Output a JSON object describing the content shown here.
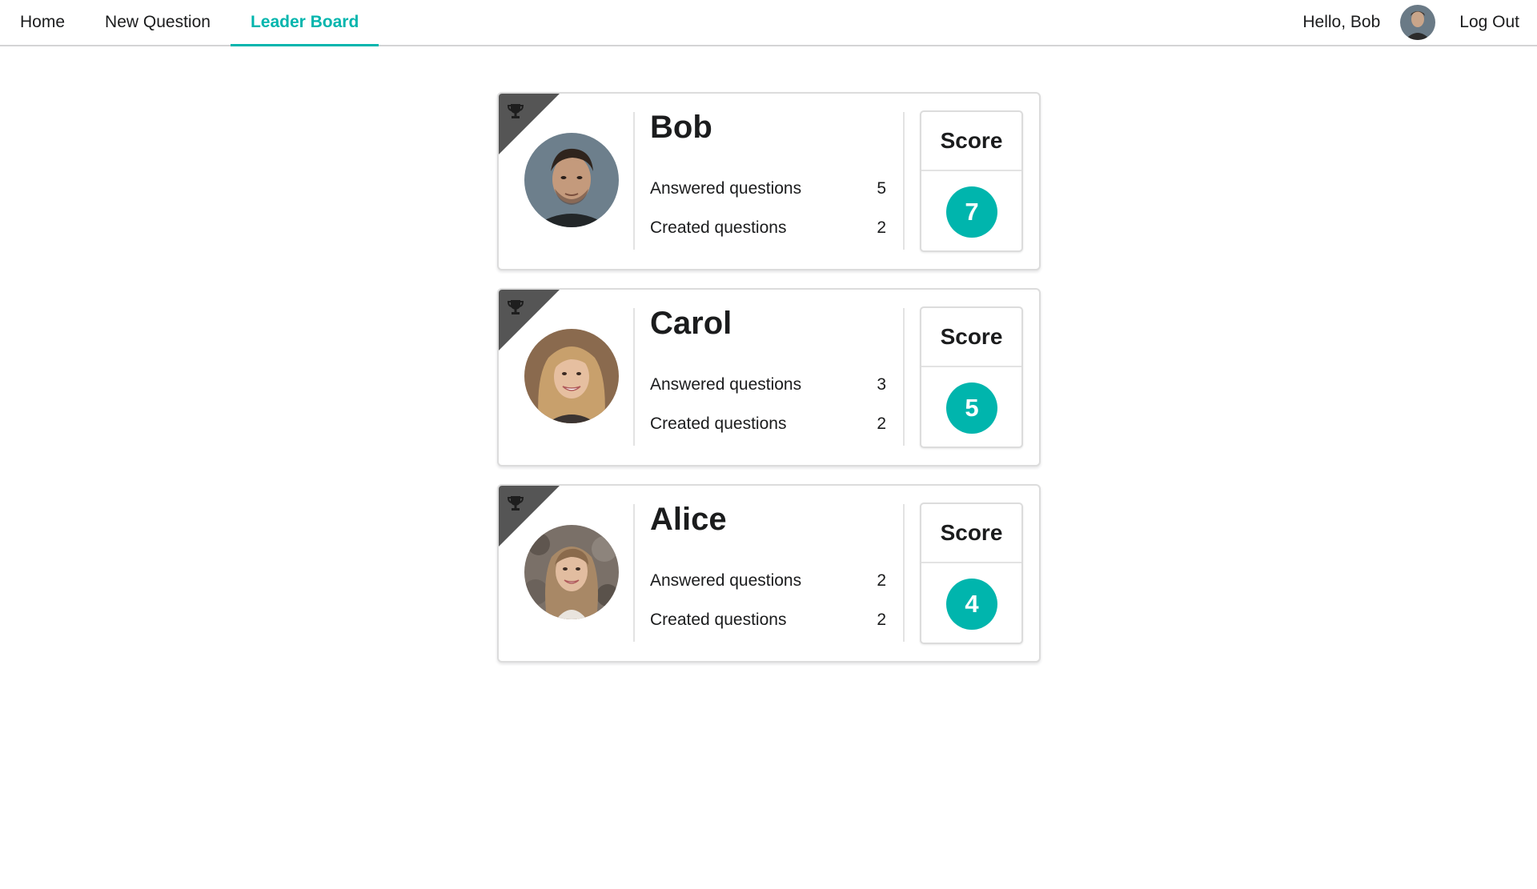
{
  "nav": {
    "items": [
      {
        "label": "Home",
        "active": false
      },
      {
        "label": "New Question",
        "active": false
      },
      {
        "label": "Leader Board",
        "active": true
      }
    ],
    "greeting": "Hello, Bob",
    "logout_label": "Log Out",
    "avatar_icon": "user-avatar-icon"
  },
  "colors": {
    "accent": "#00b5ad",
    "corner_ribbon": "#555555",
    "border": "#dcdcdc"
  },
  "leaderboard": {
    "score_label": "Score",
    "answered_label": "Answered questions",
    "created_label": "Created questions",
    "corner_icon": "trophy-icon",
    "users": [
      {
        "name": "Bob",
        "answered": "5",
        "created": "2",
        "score": "7"
      },
      {
        "name": "Carol",
        "answered": "3",
        "created": "2",
        "score": "5"
      },
      {
        "name": "Alice",
        "answered": "2",
        "created": "2",
        "score": "4"
      }
    ]
  }
}
